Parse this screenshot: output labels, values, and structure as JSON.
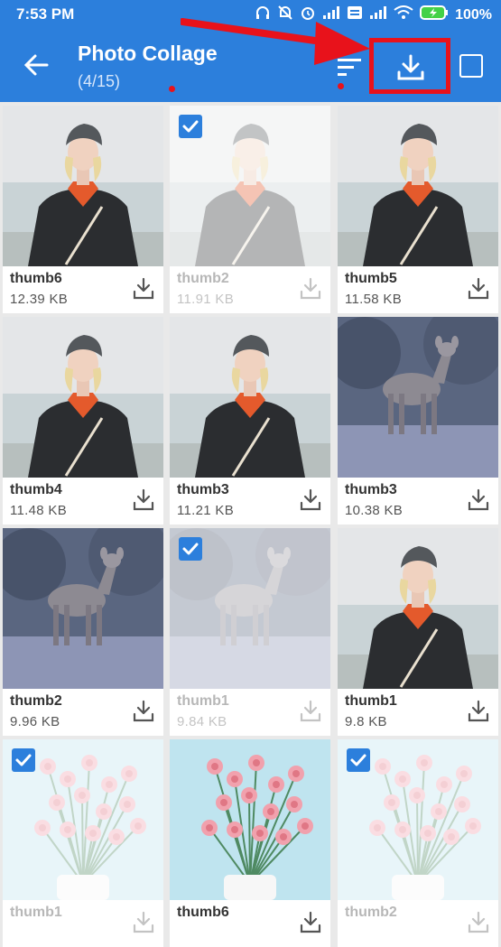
{
  "status_bar": {
    "time": "7:53 PM",
    "battery": "100%"
  },
  "header": {
    "title": "Photo Collage",
    "subtitle": "(4/15)"
  },
  "colors": {
    "appbar": "#2c7fdc",
    "highlight": "#e8121b",
    "checkbox": "#2c7fdc"
  },
  "photos": [
    {
      "name": "thumb6",
      "size": "12.39  KB",
      "selected": false,
      "image": "woman"
    },
    {
      "name": "thumb2",
      "size": "11.91  KB",
      "selected": true,
      "image": "woman"
    },
    {
      "name": "thumb5",
      "size": "11.58  KB",
      "selected": false,
      "image": "woman"
    },
    {
      "name": "thumb4",
      "size": "11.48  KB",
      "selected": false,
      "image": "woman"
    },
    {
      "name": "thumb3",
      "size": "11.21  KB",
      "selected": false,
      "image": "woman"
    },
    {
      "name": "thumb3",
      "size": "10.38  KB",
      "selected": false,
      "image": "deer"
    },
    {
      "name": "thumb2",
      "size": "9.96  KB",
      "selected": false,
      "image": "deer"
    },
    {
      "name": "thumb1",
      "size": "9.84  KB",
      "selected": true,
      "image": "deer"
    },
    {
      "name": "thumb1",
      "size": "9.8  KB",
      "selected": false,
      "image": "woman"
    },
    {
      "name": "thumb1",
      "size": "",
      "selected": true,
      "image": "flowers"
    },
    {
      "name": "thumb6",
      "size": "",
      "selected": false,
      "image": "flowers"
    },
    {
      "name": "thumb2",
      "size": "",
      "selected": true,
      "image": "flowers"
    }
  ]
}
